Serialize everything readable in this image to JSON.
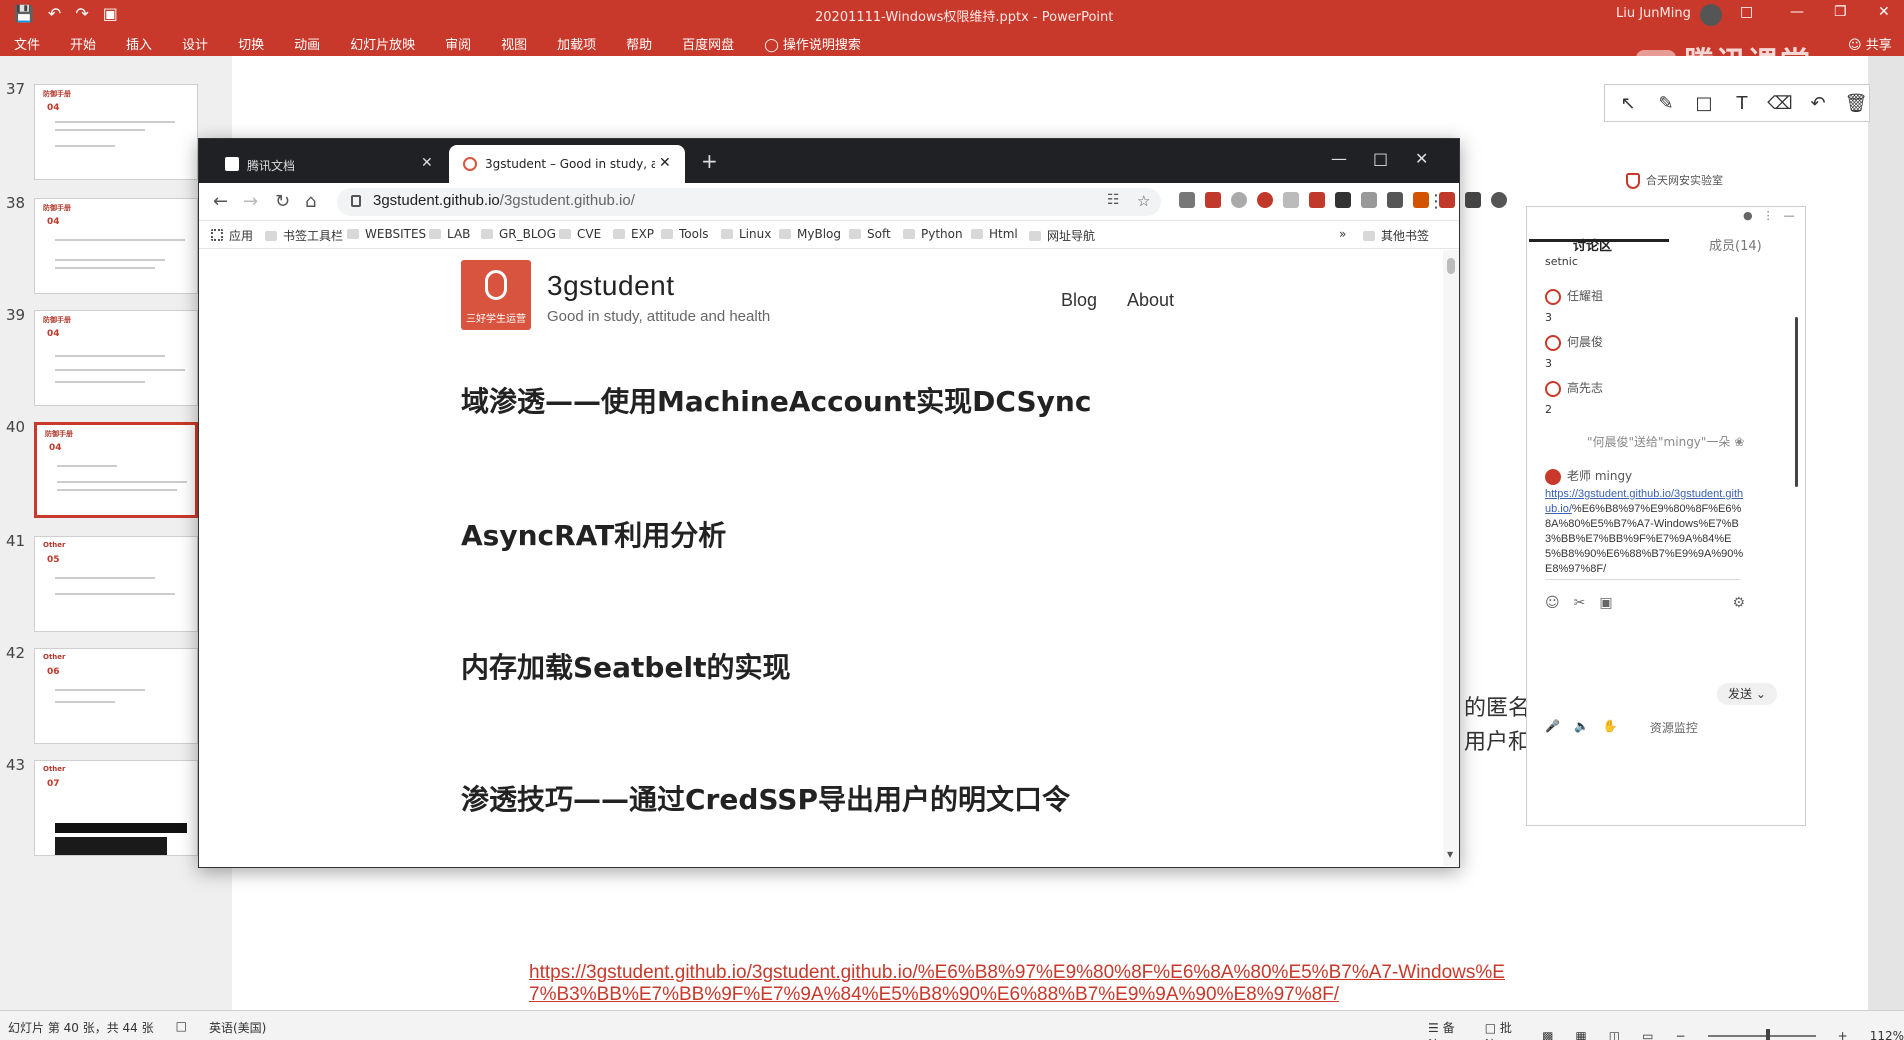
{
  "powerpoint": {
    "doc_title": "20201111-Windows权限维持.pptx",
    "app_name": "PowerPoint",
    "user_name": "Liu JunMing",
    "ribbon_tabs": [
      "文件",
      "开始",
      "插入",
      "设计",
      "切换",
      "动画",
      "幻灯片放映",
      "审阅",
      "视图",
      "加载项",
      "帮助",
      "百度网盘"
    ],
    "tell_me": "操作说明搜索",
    "share": "共享",
    "thumbs": [
      {
        "num": "37",
        "tag": "04",
        "label": "防御手册"
      },
      {
        "num": "38",
        "tag": "04",
        "label": "防御手册"
      },
      {
        "num": "39",
        "tag": "04",
        "label": "防御手册"
      },
      {
        "num": "40",
        "tag": "04",
        "label": "防御手册"
      },
      {
        "num": "41",
        "tag": "05",
        "label": "Other"
      },
      {
        "num": "42",
        "tag": "06",
        "label": "Other"
      },
      {
        "num": "43",
        "tag": "07",
        "label": "Other"
      }
    ],
    "slide_link": "https://3gstudent.github.io/3gstudent.github.io/%E6%B8%97%E9%80%8F%E6%8A%80%E5%B7%A7-Windows%E7%B3%BB%E7%BB%9F%E7%9A%84%E5%B8%90%E6%88%B7%E9%9A%90%E8%97%8F/",
    "slide_partial_1": "的匿名",
    "slide_partial_2": "用户和",
    "status": {
      "slide_count": "幻灯片 第 40 张，共 44 张",
      "lang": "英语(美国)",
      "notes": "备注",
      "comments": "批注",
      "zoom": "112%"
    }
  },
  "live": {
    "logo_text": "腾讯课堂",
    "brand": "合天网安实验室",
    "chat": {
      "tab_discussion": "讨论区",
      "tab_members": "成员(14)",
      "cut_text": "setnic",
      "messages": [
        {
          "name": "任耀祖",
          "count": "3"
        },
        {
          "name": "何晨俊",
          "count": "3"
        },
        {
          "name": "高先志",
          "count": "2"
        }
      ],
      "gift": "\"何晨俊\"送给\"mingy\"一朵",
      "teacher": "老师 mingy",
      "url_link": "https://3gstudent.github.io/3gstudent.github.io/",
      "url_rest": "%E6%B8%97%E9%80%8F%E6%8A%80%E5%B7%A7-Windows%E7%B3%BB%E7%BB%9F%E7%9A%84%E5%B8%90%E6%88%B7%E9%9A%90%E8%97%8F/",
      "send": "发送",
      "resource": "资源监控"
    }
  },
  "browser": {
    "tabs": [
      {
        "title": "腾讯文档"
      },
      {
        "title": "3gstudent – Good in study, a"
      }
    ],
    "url_host": "3gstudent.github.io",
    "url_path": "/3gstudent.github.io/",
    "bookmarks": [
      "应用",
      "书签工具栏",
      "WEBSITES",
      "LAB",
      "GR_BLOG",
      "CVE",
      "EXP",
      "Tools",
      "Linux",
      "MyBlog",
      "Soft",
      "Python",
      "Html",
      "网址导航"
    ],
    "bookmarks_more": "»",
    "bookmarks_other": "其他书签",
    "site": {
      "title": "3gstudent",
      "desc": "Good in study, attitude and health",
      "logo_caption": "三好学生运营",
      "nav": [
        "Blog",
        "About"
      ],
      "posts": [
        "域渗透——使用MachineAccount实现DCSync",
        "AsyncRAT利用分析",
        "内存加载Seatbelt的实现",
        "渗透技巧——通过CredSSP导出用户的明文口令"
      ]
    }
  }
}
